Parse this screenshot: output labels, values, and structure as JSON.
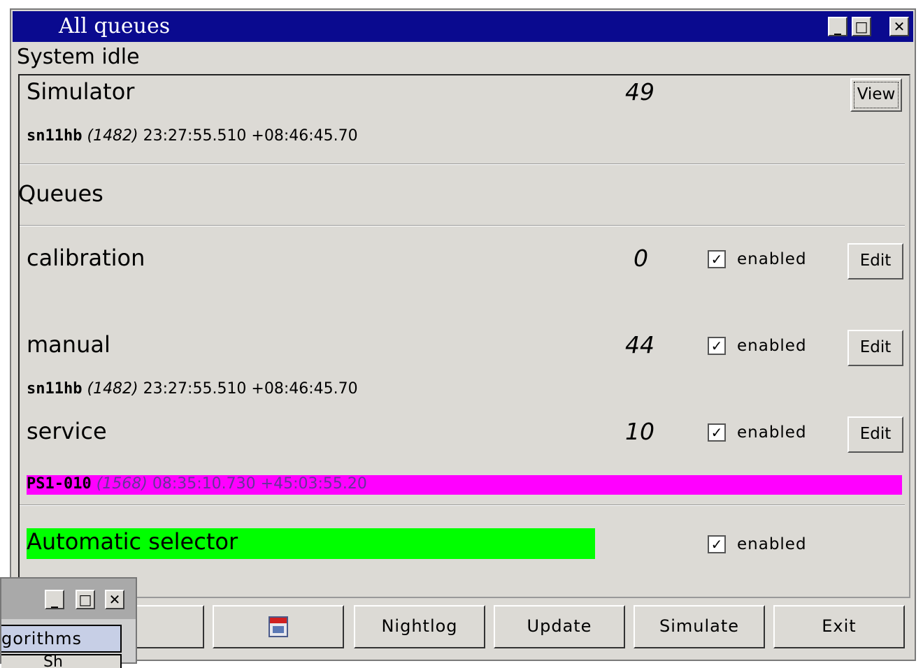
{
  "window": {
    "title": "All queues",
    "minimize": "_",
    "maximize": "□",
    "close": "✕"
  },
  "status": "System idle",
  "simulator": {
    "name": "Simulator",
    "count": "49",
    "view_label": "View",
    "target": {
      "id": "sn11hb",
      "num": "(1482)",
      "coords": "23:27:55.510 +08:46:45.70"
    }
  },
  "queues_heading": "Queues",
  "queues": [
    {
      "name": "calibration",
      "count": "0",
      "enabled_label": "enabled",
      "checked": "✓",
      "edit_label": "Edit"
    },
    {
      "name": "manual",
      "count": "44",
      "enabled_label": "enabled",
      "checked": "✓",
      "edit_label": "Edit",
      "target": {
        "id": "sn11hb",
        "num": "(1482)",
        "coords": "23:27:55.510 +08:46:45.70"
      }
    },
    {
      "name": "service",
      "count": "10",
      "enabled_label": "enabled",
      "checked": "✓",
      "edit_label": "Edit",
      "target": {
        "id": "PS1-010",
        "num": "(1568)",
        "coords": "08:35:10.730 +45:03:55.20"
      }
    }
  ],
  "auto_selector": {
    "name": "Automatic selector",
    "enabled_label": "enabled",
    "checked": "✓"
  },
  "bottom_buttons": {
    "save_icon": "calendar-save-icon",
    "nightlog": "Nightlog",
    "update": "Update",
    "simulate": "Simulate",
    "exit": "Exit"
  },
  "mini_window": {
    "minimize": "_",
    "maximize": "□",
    "close": "✕",
    "item": "gorithms",
    "item2": "Sh"
  },
  "colors": {
    "titlebar": "#0a0a8f",
    "highlight_magenta": "#ff00ff",
    "highlight_green": "#00ff00",
    "window_bg": "#dcdad5"
  }
}
